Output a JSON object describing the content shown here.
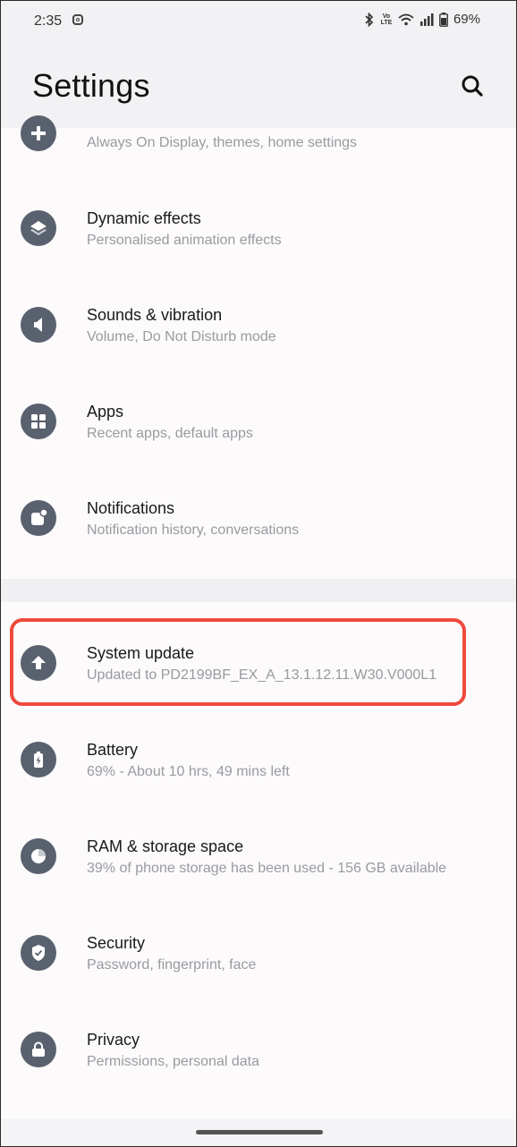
{
  "status_bar": {
    "time": "2:35",
    "battery": "69%",
    "volte_label": "Vo LTE"
  },
  "header": {
    "title": "Settings"
  },
  "items": [
    {
      "title": "",
      "subtitle": "Always On Display, themes, home settings",
      "icon": "plus-icon"
    },
    {
      "title": "Dynamic effects",
      "subtitle": "Personalised animation effects",
      "icon": "layers-icon"
    },
    {
      "title": "Sounds & vibration",
      "subtitle": "Volume, Do Not Disturb mode",
      "icon": "speaker-icon"
    },
    {
      "title": "Apps",
      "subtitle": "Recent apps, default apps",
      "icon": "apps-grid-icon"
    },
    {
      "title": "Notifications",
      "subtitle": "Notification history, conversations",
      "icon": "notification-icon"
    },
    {
      "title": "System update",
      "subtitle": "Updated to PD2199BF_EX_A_13.1.12.11.W30.V000L1",
      "icon": "upload-arrow-icon"
    },
    {
      "title": "Battery",
      "subtitle": "69% - About 10 hrs, 49 mins left",
      "icon": "battery-icon"
    },
    {
      "title": "RAM & storage space",
      "subtitle": "39% of phone storage has been used - 156 GB available",
      "icon": "storage-pie-icon"
    },
    {
      "title": "Security",
      "subtitle": "Password, fingerprint, face",
      "icon": "shield-icon"
    },
    {
      "title": "Privacy",
      "subtitle": "Permissions, personal data",
      "icon": "lock-icon"
    }
  ],
  "colors": {
    "icon_bg": "#5a616e",
    "highlight": "#ef4a3d"
  }
}
